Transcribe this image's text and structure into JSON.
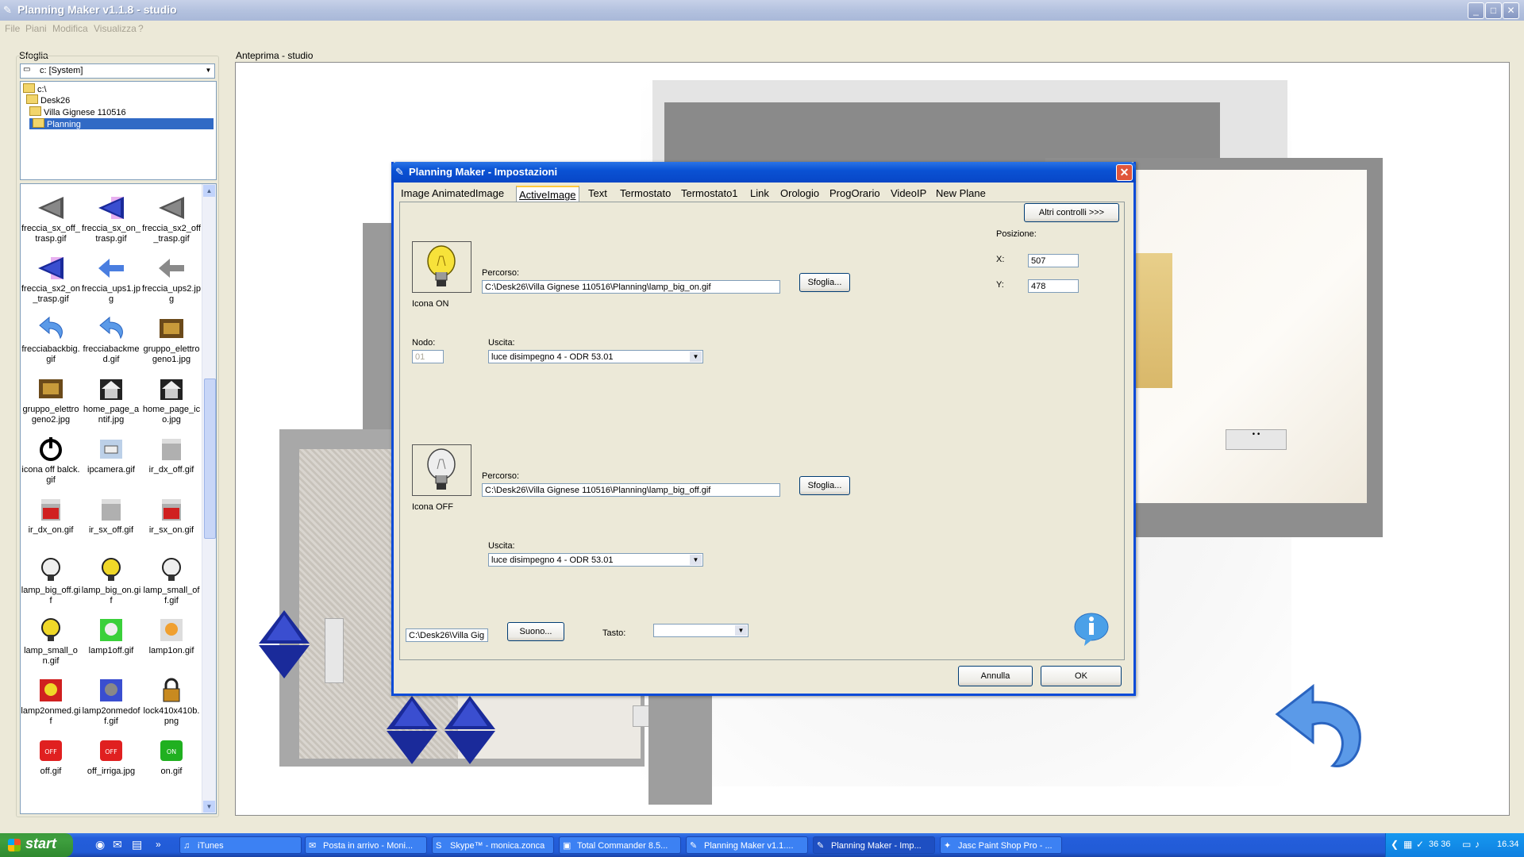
{
  "window": {
    "title": "Planning Maker v1.1.8 - studio",
    "min": "_",
    "max": "□",
    "close": "✕"
  },
  "menu": [
    "File",
    "Piani",
    "Modifica",
    "Visualizza",
    "?"
  ],
  "browse": {
    "label": "Sfoglia",
    "drive": "c: [System]",
    "tree": [
      "c:\\",
      "Desk26",
      "Villa Gignese 110516",
      "Planning"
    ],
    "files": [
      {
        "name": "freccia_sx_off_trasp.gif",
        "icon": "triangle-left-gray"
      },
      {
        "name": "freccia_sx_on_trasp.gif",
        "icon": "triangle-left-blue"
      },
      {
        "name": "freccia_sx2_off_trasp.gif",
        "icon": "triangle-left-gray"
      },
      {
        "name": "freccia_sx2_on_trasp.gif",
        "icon": "triangle-left-blue"
      },
      {
        "name": "freccia_ups1.jpg",
        "icon": "arrow-left-blue"
      },
      {
        "name": "freccia_ups2.jpg",
        "icon": "arrow-left-gray"
      },
      {
        "name": "frecciabackbig.gif",
        "icon": "back-arrow"
      },
      {
        "name": "frecciabackmed.gif",
        "icon": "back-arrow"
      },
      {
        "name": "gruppo_elettrogeno1.jpg",
        "icon": "generator"
      },
      {
        "name": "gruppo_elettrogeno2.jpg",
        "icon": "generator"
      },
      {
        "name": "home_page_antif.jpg",
        "icon": "house"
      },
      {
        "name": "home_page_ico.jpg",
        "icon": "house"
      },
      {
        "name": "icona off balck.gif",
        "icon": "power"
      },
      {
        "name": "ipcamera.gif",
        "icon": "camera"
      },
      {
        "name": "ir_dx_off.gif",
        "icon": "ir-gray"
      },
      {
        "name": "ir_dx_on.gif",
        "icon": "ir-red"
      },
      {
        "name": "ir_sx_off.gif",
        "icon": "ir-gray"
      },
      {
        "name": "ir_sx_on.gif",
        "icon": "ir-red"
      },
      {
        "name": "lamp_big_off.gif",
        "icon": "bulb-off"
      },
      {
        "name": "lamp_big_on.gif",
        "icon": "bulb-on"
      },
      {
        "name": "lamp_small_off.gif",
        "icon": "bulb-off"
      },
      {
        "name": "lamp_small_on.gif",
        "icon": "bulb-on"
      },
      {
        "name": "lamp1off.gif",
        "icon": "lamp-green"
      },
      {
        "name": "lamp1on.gif",
        "icon": "lamp-orange"
      },
      {
        "name": "lamp2onmed.gif",
        "icon": "lamp-red"
      },
      {
        "name": "lamp2onmedoff.gif",
        "icon": "lamp-blue"
      },
      {
        "name": "lock410x410b.png",
        "icon": "lock"
      },
      {
        "name": "off.gif",
        "icon": "off-red"
      },
      {
        "name": "off_irriga.jpg",
        "icon": "off-red"
      },
      {
        "name": "on.gif",
        "icon": "on-green"
      }
    ]
  },
  "preview": {
    "label": "Anteprima - studio"
  },
  "dialog": {
    "title": "Planning Maker - Impostazioni",
    "tabs": [
      "Image",
      "AnimatedImage",
      "ActiveImage",
      "Text",
      "Termostato",
      "Termostato1",
      "Link",
      "Orologio",
      "ProgOrario",
      "VideoIP",
      "New Plane"
    ],
    "active_tab": "ActiveImage",
    "altri_controlli": "Altri controlli >>>",
    "posizione_label": "Posizione:",
    "x_label": "X:",
    "x_value": "507",
    "y_label": "Y:",
    "y_value": "478",
    "on": {
      "caption": "Icona ON",
      "percorso_label": "Percorso:",
      "percorso": "C:\\Desk26\\Villa Gignese 110516\\Planning\\lamp_big_on.gif",
      "sfoglia": "Sfoglia...",
      "nodo_label": "Nodo:",
      "nodo_value": "01",
      "uscita_label": "Uscita:",
      "uscita": "luce disimpegno 4 - ODR 53.01"
    },
    "off": {
      "caption": "Icona OFF",
      "percorso_label": "Percorso:",
      "percorso": "C:\\Desk26\\Villa Gignese 110516\\Planning\\lamp_big_off.gif",
      "sfoglia": "Sfoglia...",
      "uscita_label": "Uscita:",
      "uscita": "luce disimpegno 4 - ODR 53.01"
    },
    "sound_path": "C:\\Desk26\\Villa Gig",
    "suono": "Suono...",
    "tasto_label": "Tasto:",
    "tasto_value": "",
    "annulla": "Annulla",
    "ok": "OK"
  },
  "taskbar": {
    "start": "start",
    "tasks": [
      "iTunes",
      "Posta in arrivo - Moni...",
      "Skype™ - monica.zonca",
      "Total Commander 8.5...",
      "Planning Maker v1.1....",
      "Planning Maker - Imp...",
      "Jasc Paint Shop Pro - ..."
    ],
    "clock": "16.34",
    "tray_nums": "36 36"
  },
  "colors": {
    "accent": "#0a52d4",
    "selection": "#316ac5",
    "taskbar": "#245edb",
    "start": "#3c9a3c"
  }
}
